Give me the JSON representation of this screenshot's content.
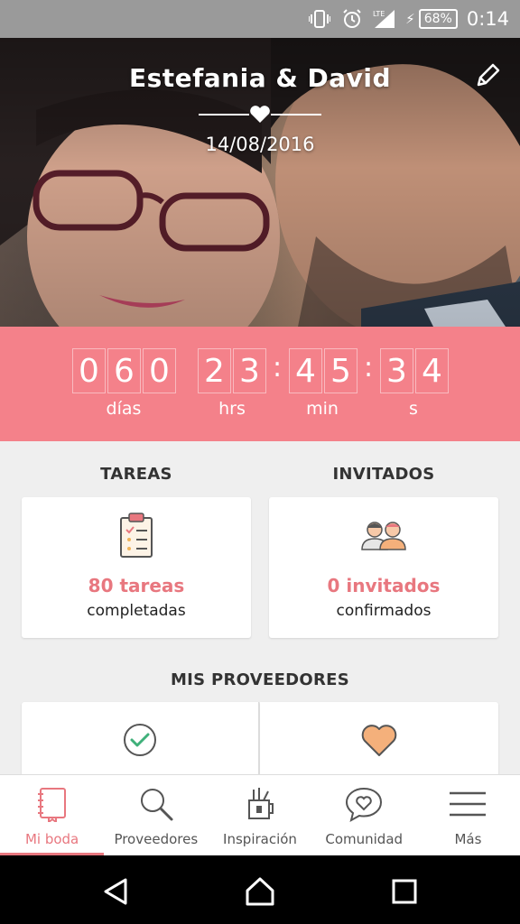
{
  "status_bar": {
    "battery": "68%",
    "network": "LTE",
    "time": "0:14"
  },
  "header": {
    "couple_names": "Estefania & David",
    "date": "14/08/2016"
  },
  "countdown": {
    "days_digits": [
      "0",
      "6",
      "0"
    ],
    "hours_digits": [
      "2",
      "3"
    ],
    "minutes_digits": [
      "4",
      "5"
    ],
    "seconds_digits": [
      "3",
      "4"
    ],
    "labels": {
      "days": "días",
      "hours": "hrs",
      "minutes": "min",
      "seconds": "s"
    }
  },
  "tasks": {
    "title": "TAREAS",
    "count": "80 tareas",
    "subtitle": "completadas"
  },
  "guests": {
    "title": "INVITADOS",
    "count": "0 invitados",
    "subtitle": "confirmados"
  },
  "providers": {
    "title": "MIS PROVEEDORES"
  },
  "bottom_nav": {
    "items": [
      {
        "label": "Mi boda",
        "icon": "notebook-icon",
        "active": true
      },
      {
        "label": "Proveedores",
        "icon": "search-icon",
        "active": false
      },
      {
        "label": "Inspiración",
        "icon": "brush-cup-icon",
        "active": false
      },
      {
        "label": "Comunidad",
        "icon": "chat-heart-icon",
        "active": false
      },
      {
        "label": "Más",
        "icon": "menu-icon",
        "active": false
      }
    ]
  },
  "colors": {
    "accent": "#f4818a",
    "accent_text": "#e8777f",
    "background": "#efefef"
  }
}
